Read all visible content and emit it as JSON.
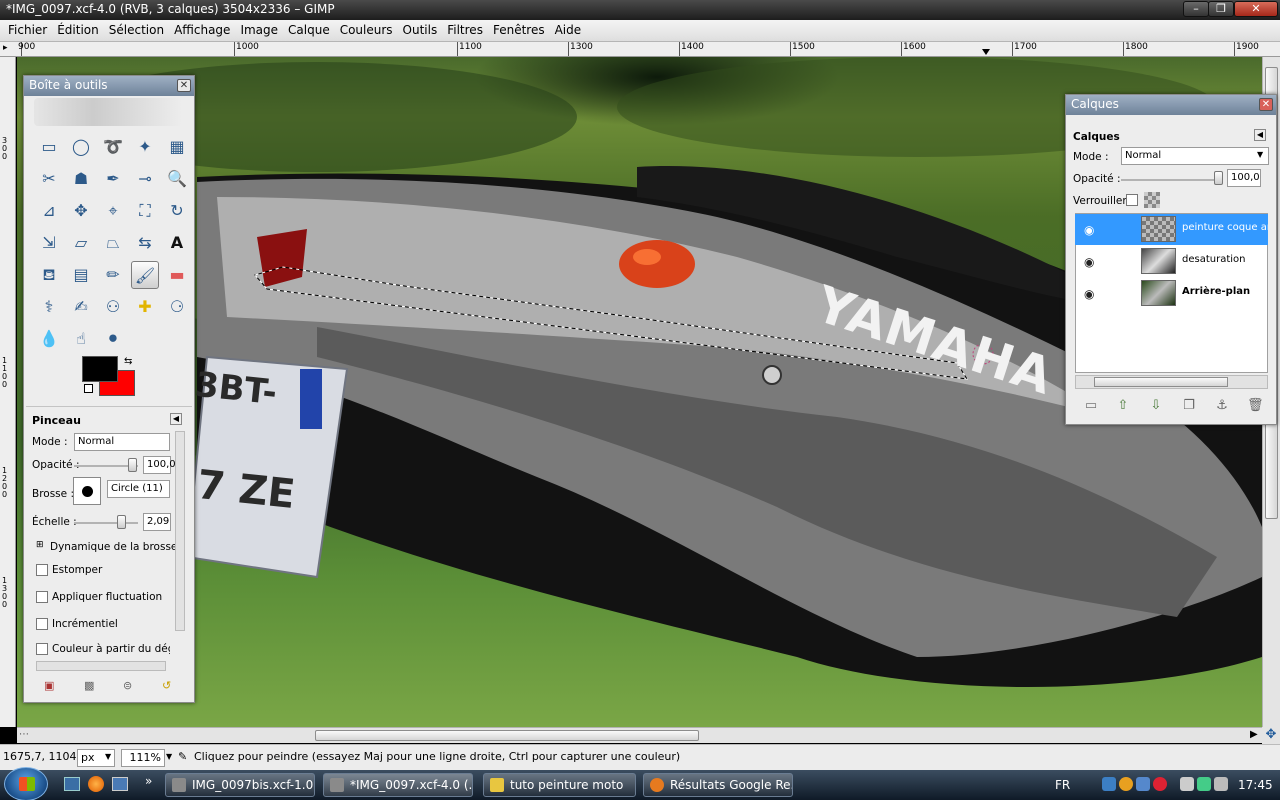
{
  "window": {
    "title": "*IMG_0097.xcf-4.0 (RVB, 3 calques) 3504x2336 – GIMP",
    "controls": [
      "–",
      "❐",
      "✕"
    ]
  },
  "menu": [
    "Fichier",
    "Édition",
    "Sélection",
    "Affichage",
    "Image",
    "Calque",
    "Couleurs",
    "Outils",
    "Filtres",
    "Fenêtres",
    "Aide"
  ],
  "ruler": {
    "top_labels": [
      "900",
      "1000",
      "1100",
      "1200",
      "1300",
      "1400",
      "1500",
      "1600",
      "1700",
      "1800",
      "1900"
    ],
    "left_labels": [
      "300",
      "1100",
      "1200",
      "1300"
    ]
  },
  "toolbox": {
    "title": "Boîte à outils",
    "tools": [
      "rect-select",
      "ellipse-select",
      "free-select",
      "fuzzy-select",
      "color-select",
      "scissors",
      "foreground-select",
      "paths",
      "color-picker",
      "zoom",
      "measure",
      "move",
      "align",
      "crop",
      "rotate",
      "scale",
      "shear",
      "perspective",
      "flip",
      "text",
      "bucket-fill",
      "blend",
      "pencil",
      "paintbrush",
      "eraser",
      "airbrush",
      "ink",
      "clone",
      "heal",
      "perspective-clone",
      "blur",
      "smudge",
      "dodge-burn"
    ],
    "colors": {
      "foreground": "#000000",
      "background": "#ff0000"
    },
    "options": {
      "tool_name": "Pinceau",
      "mode_label": "Mode :",
      "mode_value": "Normal",
      "opacity_label": "Opacité :",
      "opacity_value": "100,0",
      "opacity_level": 1.0,
      "brush_label": "Brosse :",
      "brush_value": "Circle (11)",
      "scale_label": "Échelle :",
      "scale_value": "2,09",
      "dynamics_label": "Dynamique de la brosse",
      "fade_label": "Estomper",
      "jitter_label": "Appliquer fluctuation",
      "incremental_label": "Incrémentiel",
      "gradient_label": "Couleur à partir du dégradé"
    }
  },
  "layers": {
    "title": "Calques",
    "subtitle": "Calques",
    "mode_label": "Mode :",
    "mode_value": "Normal",
    "opacity_label": "Opacité :",
    "opacity_value": "100,0",
    "lock_label": "Verrouiller :",
    "items": [
      {
        "name": "peinture coque arrière",
        "selected": true
      },
      {
        "name": "desaturation",
        "selected": false
      },
      {
        "name": "Arrière-plan",
        "selected": false
      }
    ]
  },
  "status": {
    "coords": "1675,7, 1104,5",
    "unit": "px",
    "zoom": "111%",
    "message": "Cliquez pour peindre (essayez Maj pour une ligne droite, Ctrl pour capturer une couleur)"
  },
  "taskbar": {
    "items": [
      {
        "label": "IMG_0097bis.xcf-1.0 ...",
        "icon_color": "#8a8a8a"
      },
      {
        "label": "*IMG_0097.xcf-4.0 (...",
        "icon_color": "#8a8a8a"
      },
      {
        "label": "tuto peinture moto",
        "icon_color": "#e8c640"
      },
      {
        "label": "Résultats Google Re...",
        "icon_color": "#e67a1f"
      }
    ],
    "language": "FR",
    "time": "17:45"
  },
  "canvas_text": {
    "brand": "YAMAHA",
    "plate_1": "3BT-",
    "plate_2": "7 ZE"
  }
}
